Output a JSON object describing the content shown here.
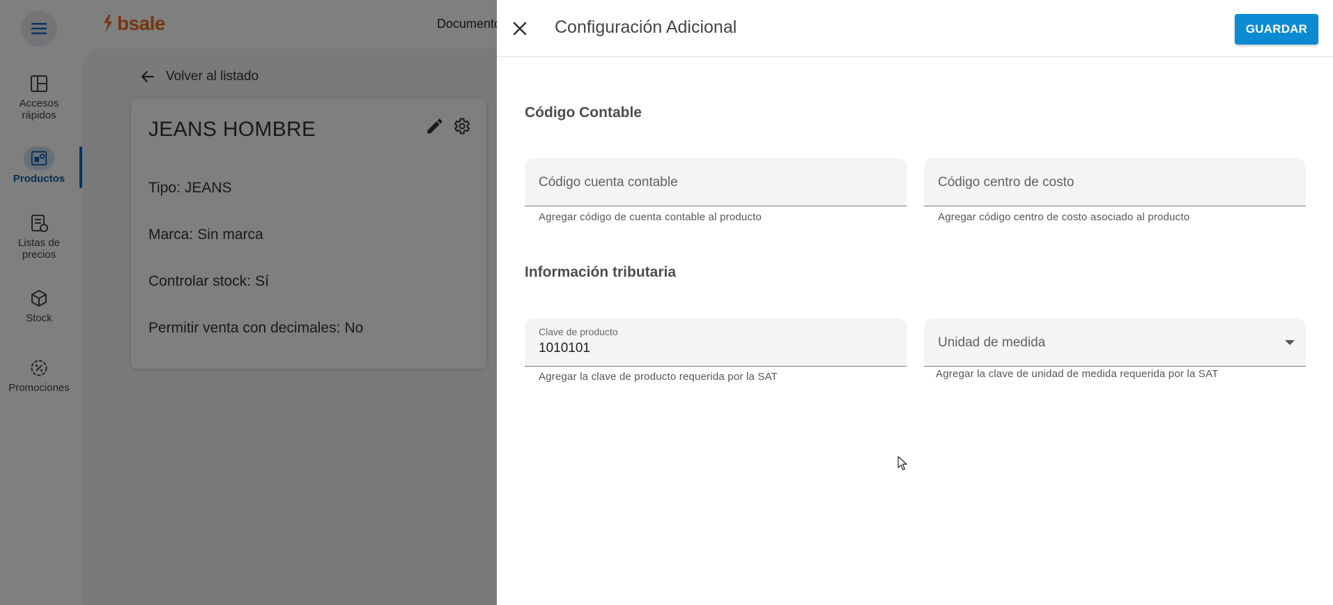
{
  "app": {
    "logo_text": "bsale",
    "top_nav_partial": "Documento"
  },
  "sidebar": {
    "items": [
      {
        "label_line1": "Accesos",
        "label_line2": "rápidos",
        "icon": "dashboard-icon"
      },
      {
        "label_line1": "Productos",
        "label_line2": "",
        "icon": "products-icon",
        "active": true
      },
      {
        "label_line1": "Listas de",
        "label_line2": "precios",
        "icon": "price-list-icon"
      },
      {
        "label_line1": "Stock",
        "label_line2": "",
        "icon": "box-icon"
      },
      {
        "label_line1": "Promociones",
        "label_line2": "",
        "icon": "discount-icon"
      }
    ]
  },
  "product": {
    "back_label": "Volver al listado",
    "title": "JEANS HOMBRE",
    "attributes": [
      {
        "label": "Tipo:",
        "value": "JEANS"
      },
      {
        "label": "Marca:",
        "value": "Sin marca"
      },
      {
        "label": "Controlar stock:",
        "value": "Sí"
      },
      {
        "label": "Permitir venta con decimales:",
        "value": "No"
      }
    ]
  },
  "drawer": {
    "title": "Configuración Adicional",
    "save_label": "GUARDAR",
    "sections": {
      "accounting": {
        "title": "Código Contable",
        "account_code": {
          "placeholder": "Código cuenta contable",
          "hint": "Agregar código de cuenta contable al producto"
        },
        "cost_center": {
          "placeholder": "Código centro de costo",
          "hint": "Agregar código centro de costo asociado al producto"
        }
      },
      "tax": {
        "title": "Información tributaria",
        "product_key": {
          "label": "Clave de producto",
          "value": "1010101",
          "hint": "Agregar la clave de producto requerida por la SAT"
        },
        "unit": {
          "placeholder": "Unidad de medida",
          "hint": "Agregar la clave de unidad de medida requerida por la SAT"
        }
      }
    }
  },
  "colors": {
    "brand_orange": "#ee6a1e",
    "primary_blue": "#0c8bd3",
    "active_nav": "#1565c0"
  }
}
